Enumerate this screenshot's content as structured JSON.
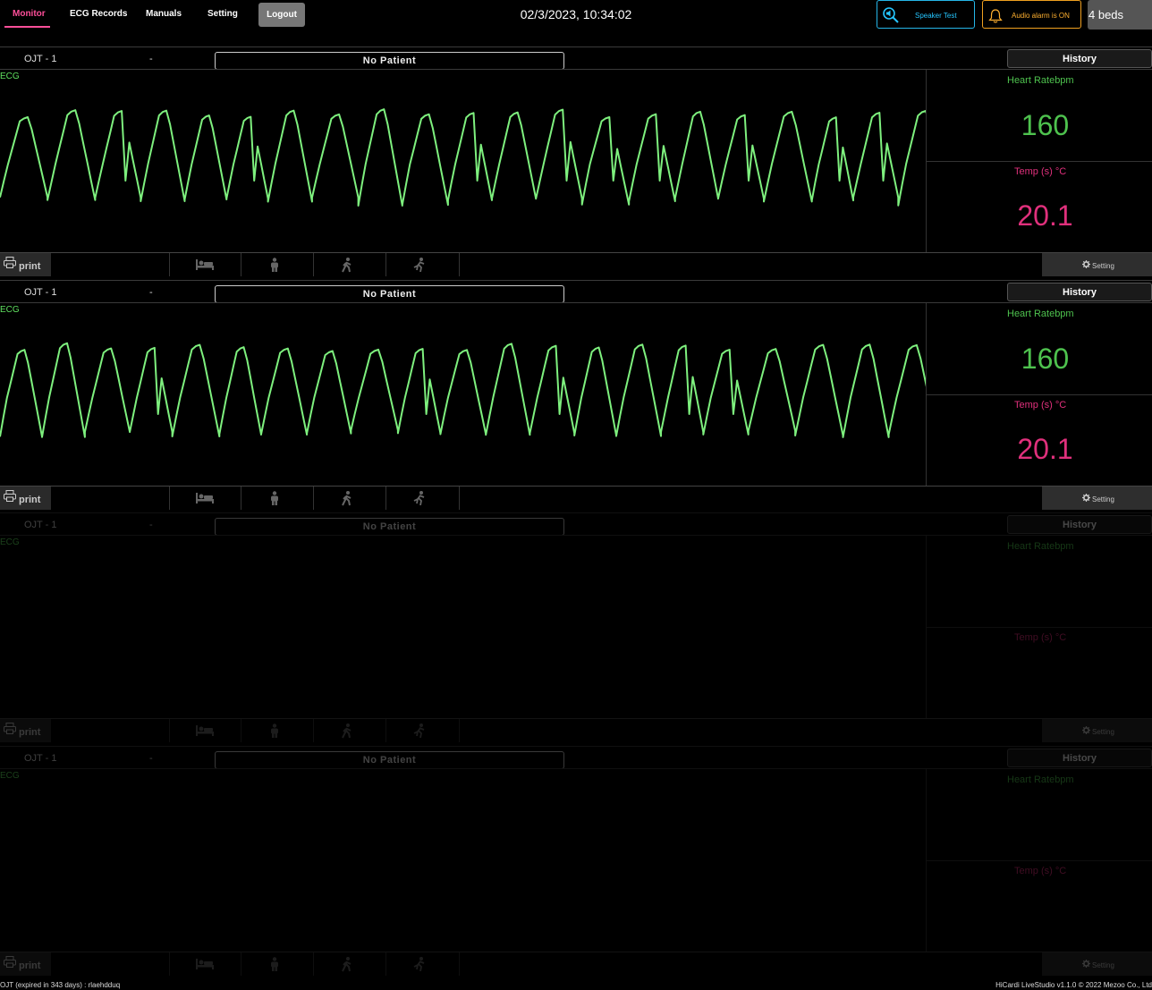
{
  "nav": {
    "items": [
      {
        "label": "Monitor",
        "active": true
      },
      {
        "label": "ECG Records",
        "active": false
      },
      {
        "label": "Manuals",
        "active": false
      },
      {
        "label": "Setting",
        "active": false
      }
    ],
    "logout_label": "Logout"
  },
  "datetime": "02/3/2023, 10:34:02",
  "controls": {
    "speaker_test_label": "Speaker Test",
    "audio_alarm_label": "Audio alarm is ON",
    "beds_label": "4 beds"
  },
  "panels": [
    {
      "bed_name": "OJT - 1",
      "dash": "-",
      "patient": "No Patient",
      "history_label": "History",
      "waveform_label": "ECG",
      "hr_label": "Heart Ratebpm",
      "hr_value": "160",
      "temp_label": "Temp (s) °C",
      "temp_value": "20.1",
      "print_label": "print",
      "setting_label": "Setting",
      "active": true
    },
    {
      "bed_name": "OJT - 1",
      "dash": "-",
      "patient": "No Patient",
      "history_label": "History",
      "waveform_label": "ECG",
      "hr_label": "Heart Ratebpm",
      "hr_value": "160",
      "temp_label": "Temp (s) °C",
      "temp_value": "20.1",
      "print_label": "print",
      "setting_label": "Setting",
      "active": true
    },
    {
      "bed_name": "OJT - 1",
      "dash": "-",
      "patient": "No Patient",
      "history_label": "History",
      "waveform_label": "ECG",
      "hr_label": "Heart Ratebpm",
      "hr_value": "",
      "temp_label": "Temp (s) °C",
      "temp_value": "",
      "print_label": "print",
      "setting_label": "Setting",
      "active": false
    },
    {
      "bed_name": "OJT - 1",
      "dash": "-",
      "patient": "No Patient",
      "history_label": "History",
      "waveform_label": "ECG",
      "hr_label": "Heart Ratebpm",
      "hr_value": "",
      "temp_label": "Temp (s) °C",
      "temp_value": "",
      "print_label": "print",
      "setting_label": "Setting",
      "active": false
    }
  ],
  "mode_icons": [
    "bed-icon",
    "standing-person-icon",
    "walking-icon",
    "running-icon"
  ],
  "colors": {
    "accent": "#ff4f9a",
    "heart_rate": "#4ec24e",
    "temperature": "#e0307c",
    "waveform": "#7ef07e",
    "speaker": "#25c6ff",
    "alarm": "#ffb030"
  },
  "status": {
    "left": "OJT (expired in 343 days) : rlaehdduq",
    "right": "HiCardi LiveStudio v1.1.0 © 2022 Mezoo Co., Ltd"
  }
}
